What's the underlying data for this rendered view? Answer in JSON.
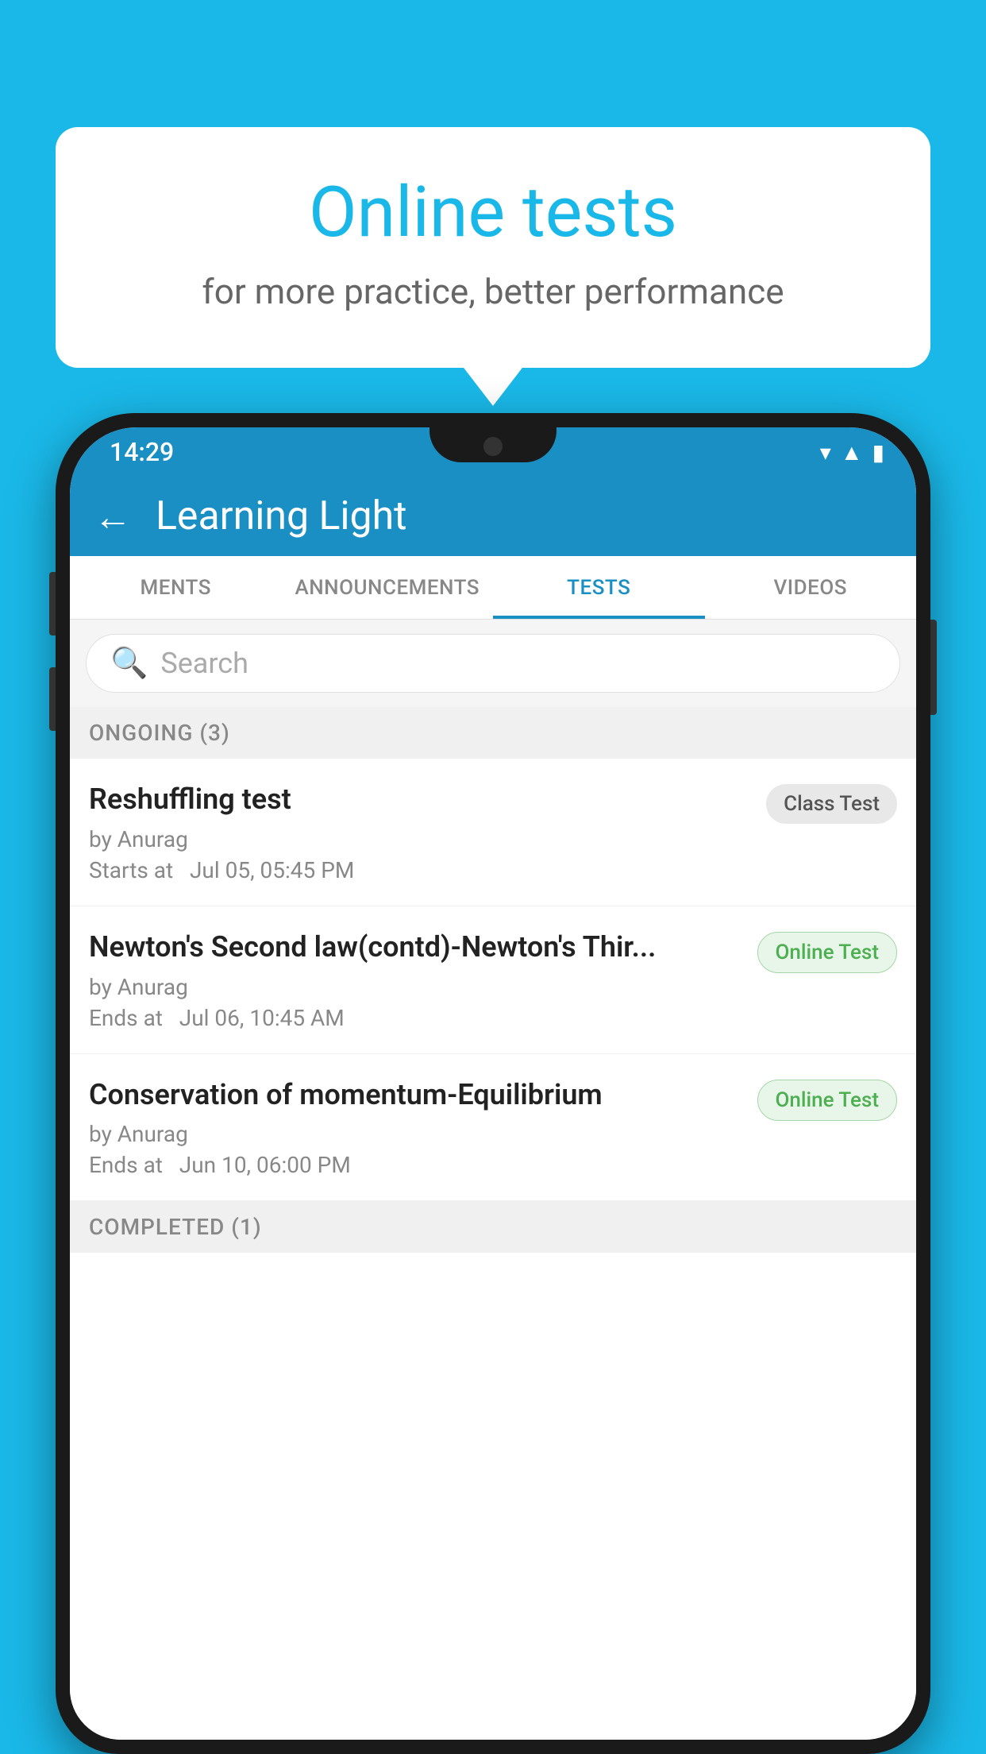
{
  "background_color": "#1ab8e8",
  "speech_bubble": {
    "title": "Online tests",
    "subtitle": "for more practice, better performance"
  },
  "phone": {
    "status_bar": {
      "time": "14:29",
      "icons": [
        "wifi",
        "signal",
        "battery"
      ]
    },
    "header": {
      "title": "Learning Light",
      "back_label": "←"
    },
    "tabs": [
      {
        "label": "MENTS",
        "active": false
      },
      {
        "label": "ANNOUNCEMENTS",
        "active": false
      },
      {
        "label": "TESTS",
        "active": true
      },
      {
        "label": "VIDEOS",
        "active": false
      }
    ],
    "search": {
      "placeholder": "Search"
    },
    "ongoing_section": {
      "label": "ONGOING (3)"
    },
    "test_items": [
      {
        "name": "Reshuffling test",
        "by": "by Anurag",
        "time_label": "Starts at",
        "time": "Jul 05, 05:45 PM",
        "badge": "Class Test",
        "badge_type": "class"
      },
      {
        "name": "Newton's Second law(contd)-Newton's Thir...",
        "by": "by Anurag",
        "time_label": "Ends at",
        "time": "Jul 06, 10:45 AM",
        "badge": "Online Test",
        "badge_type": "online"
      },
      {
        "name": "Conservation of momentum-Equilibrium",
        "by": "by Anurag",
        "time_label": "Ends at",
        "time": "Jun 10, 06:00 PM",
        "badge": "Online Test",
        "badge_type": "online"
      }
    ],
    "completed_section": {
      "label": "COMPLETED (1)"
    }
  }
}
